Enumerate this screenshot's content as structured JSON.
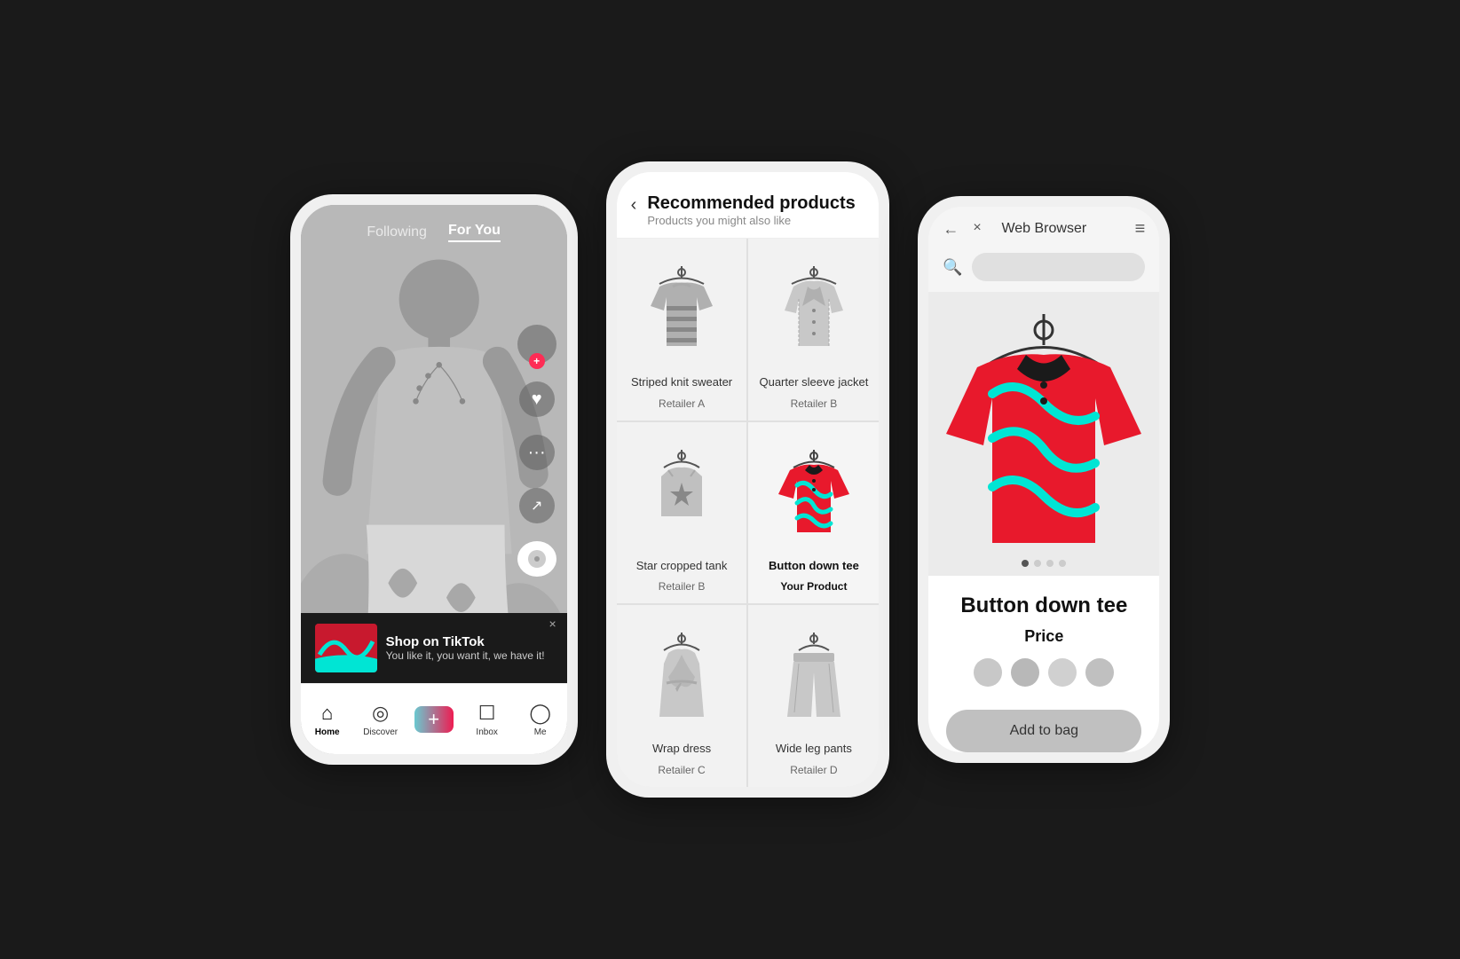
{
  "phones": {
    "phone1": {
      "header": {
        "following_label": "Following",
        "for_you_label": "For You"
      },
      "ad_banner": {
        "title": "Shop on TikTok",
        "subtitle": "You like it, you want it, we have it!",
        "close_label": "×"
      },
      "nav": {
        "home_label": "Home",
        "discover_label": "Discover",
        "plus_label": "+",
        "inbox_label": "Inbox",
        "me_label": "Me"
      }
    },
    "phone2": {
      "header": {
        "back_label": "‹",
        "title": "Recommended products",
        "subtitle": "Products you might also like"
      },
      "products": [
        {
          "name": "Striped knit sweater",
          "retailer": "Retailer A",
          "highlighted": false,
          "type": "sweater"
        },
        {
          "name": "Quarter sleeve jacket",
          "retailer": "Retailer B",
          "highlighted": false,
          "type": "jacket"
        },
        {
          "name": "Star cropped tank",
          "retailer": "Retailer B",
          "highlighted": false,
          "type": "tank"
        },
        {
          "name": "Button down tee",
          "retailer": "Your Product",
          "highlighted": true,
          "type": "tee"
        },
        {
          "name": "Wrap dress",
          "retailer": "Retailer C",
          "highlighted": false,
          "type": "dress"
        },
        {
          "name": "Wide leg pants",
          "retailer": "Retailer D",
          "highlighted": false,
          "type": "pants"
        }
      ]
    },
    "phone3": {
      "browser_title": "Web Browser",
      "product_name": "Button down tee",
      "product_price": "Price",
      "add_to_bag_label": "Add to bag",
      "dot_count": 4,
      "swatches": 4,
      "nav_back": "←",
      "nav_close": "×",
      "menu_icon": "≡"
    }
  },
  "colors": {
    "tiktok_red": "#fe2c55",
    "teal": "#25f4ee",
    "brand_teal": "#00e5d4",
    "dark": "#1a1a1a"
  }
}
